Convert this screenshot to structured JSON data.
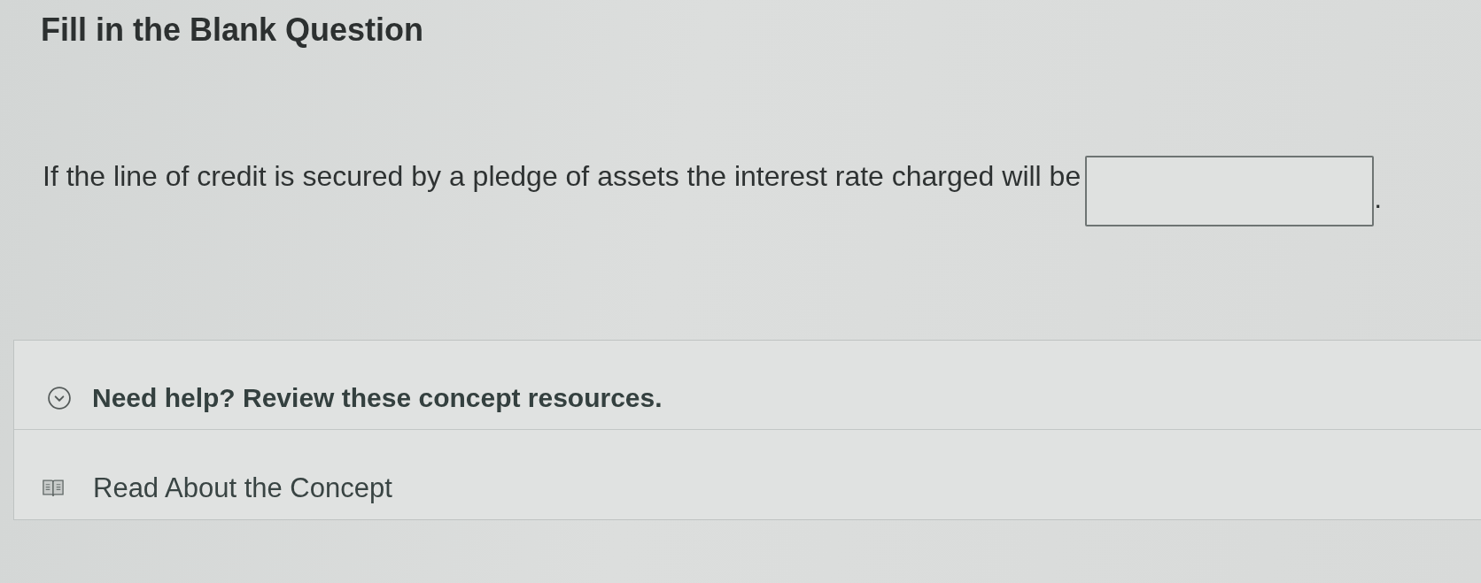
{
  "title": "Fill in the Blank Question",
  "question": {
    "parts": [
      {
        "kind": "text",
        "text": "If the line of credit is secured by a pledge of assets the interest rate charged will be"
      },
      {
        "kind": "blank"
      },
      {
        "kind": "text",
        "text": "."
      }
    ]
  },
  "help": {
    "expanded": true,
    "heading": "Need help? Review these concept resources.",
    "resources": [
      {
        "label": "Read About the Concept"
      }
    ]
  }
}
